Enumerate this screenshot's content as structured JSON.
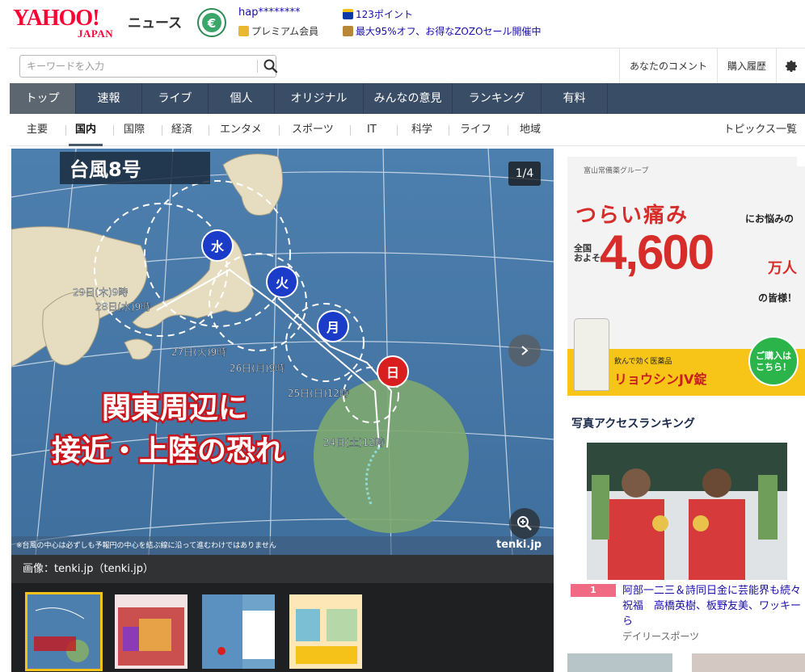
{
  "header": {
    "logo_main": "YAHOO!",
    "logo_sub": "JAPAN",
    "service_name": "ニュース",
    "username": "hap********",
    "membership": "プレミアム会員",
    "points": "123ポイント",
    "promo": "最大95%オフ、お得なZOZOセール開催中"
  },
  "search": {
    "placeholder": "キーワードを入力",
    "comment_link": "あなたのコメント",
    "history_link": "購入履歴"
  },
  "nav_primary": [
    "トップ",
    "速報",
    "ライブ",
    "個人",
    "オリジナル",
    "みんなの意見",
    "ランキング",
    "有料"
  ],
  "nav_secondary": [
    "主要",
    "国内",
    "国際",
    "経済",
    "エンタメ",
    "スポーツ",
    "IT",
    "科学",
    "ライフ",
    "地域"
  ],
  "nav_secondary_active": "国内",
  "nav_topics": "トピックス一覧",
  "hero": {
    "counter": "1/4",
    "caption": "画像：tenki.jp（tenki.jp）",
    "map_title": "台風8号",
    "headline_line1": "関東周辺に",
    "headline_line2": "接近・上陸の恐れ",
    "day_markers": [
      "水",
      "火",
      "月",
      "日"
    ],
    "track_labels": [
      "29日(木)9時",
      "28日(水)9時",
      "27日(火)9時",
      "26日(月)9時",
      "25日(日)12時",
      "24日(土)12時"
    ],
    "footnote": "※台風の中心は必ずしも予報円の中心を結ぶ線に沿って進むわけではありません",
    "watermark": "tenki.jp"
  },
  "ad": {
    "brand": "富山常備薬グループ",
    "headline1": "つらい痛み",
    "headline2": "にお悩みの",
    "kokunai": "全国\nおよそ",
    "big_number": "4,600",
    "unit": "万人",
    "suffix": "の皆様！",
    "product_sub": "飲んで効く医薬品",
    "product": "リョウシンJV錠",
    "cta": "ご購入は\nこちら！"
  },
  "ranking": {
    "heading": "写真アクセスランキング",
    "item_rank": "1",
    "item_title": "阿部一二三＆詩同日金に芸能界も続々祝福　高橋英樹、板野友美、ワッキーら",
    "item_source": "デイリースポーツ"
  },
  "colors": {
    "brand_red": "#ff0033",
    "nav_bg": "#3a4d66",
    "rank_badge": "#f06a83"
  }
}
